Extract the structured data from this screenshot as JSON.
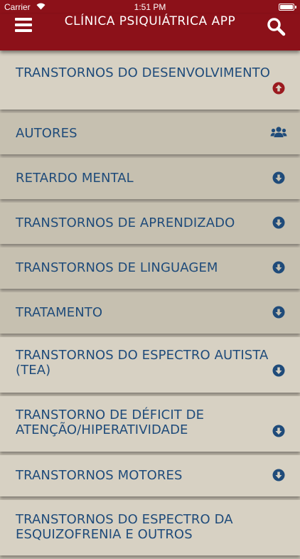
{
  "status_bar": {
    "carrier": "Carrier",
    "time": "1:51 PM"
  },
  "nav": {
    "title": "CLÍNICA PSIQUIÁTRICA APP"
  },
  "items": [
    {
      "label": "TRANSTORNOS DO DESENVOLVIMENTO",
      "icon": "arrow-up-circle-icon"
    },
    {
      "label": "AUTORES",
      "icon": "users-icon"
    },
    {
      "label": "RETARDO MENTAL",
      "icon": "arrow-down-circle-icon"
    },
    {
      "label": "TRANSTORNOS DE APRENDIZADO",
      "icon": "arrow-down-circle-icon"
    },
    {
      "label": "TRANSTORNOS DE LINGUAGEM",
      "icon": "arrow-down-circle-icon"
    },
    {
      "label": "TRATAMENTO",
      "icon": "arrow-down-circle-icon"
    },
    {
      "label": "TRANSTORNOS DO ESPECTRO AUTISTA (TEA)",
      "icon": "arrow-down-circle-icon"
    },
    {
      "label": "TRANSTORNO DE DÉFICIT DE ATENÇÃO/HIPERATIVIDADE",
      "icon": "arrow-down-circle-icon"
    },
    {
      "label": "TRANSTORNOS MOTORES",
      "icon": "arrow-down-circle-icon"
    },
    {
      "label": "TRANSTORNOS DO ESPECTRO DA ESQUIZOFRENIA E OUTROS",
      "icon": "arrow-down-circle-icon"
    }
  ],
  "colors": {
    "header": "#8c1119",
    "text": "#1f4b7a",
    "expanded_icon": "#9b1a1f",
    "row_light": "#d7d1c3",
    "row_dark": "#c6c0b0"
  }
}
